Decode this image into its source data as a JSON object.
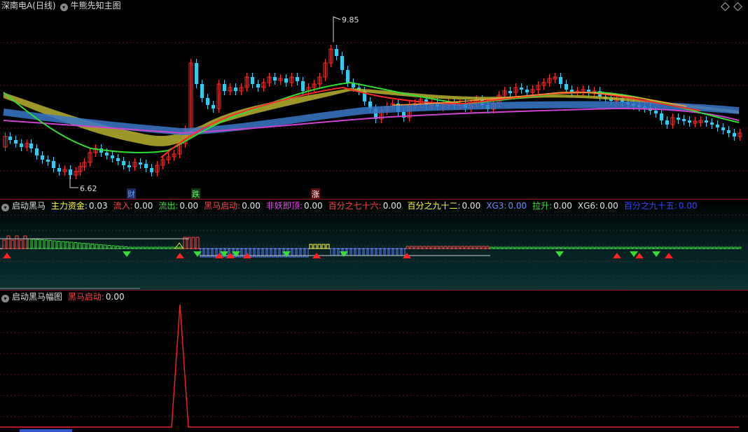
{
  "main": {
    "stock": "深南电A(日线)",
    "indicator": "牛熊先知主图",
    "high_label": "9.85",
    "low_label": "6.62",
    "markers": [
      {
        "text": "财",
        "color": "#4a8cff"
      },
      {
        "text": "跌",
        "color": "#33dd33"
      },
      {
        "text": "涨",
        "color": "#ff3333"
      }
    ]
  },
  "sub1": {
    "name": "启动黑马",
    "fields": [
      {
        "label": "主力资金:",
        "value": "0.03",
        "color": "#ffff33"
      },
      {
        "label": "流入:",
        "value": "0.00",
        "color": "#ff4444"
      },
      {
        "label": "流出:",
        "value": "0.00",
        "color": "#33dd33"
      },
      {
        "label": "黑马启动:",
        "value": "0.00",
        "color": "#ff4444"
      },
      {
        "label": "非妖即顶:",
        "value": "0.00",
        "color": "#ee44ee"
      },
      {
        "label": "百分之七十六:",
        "value": "0.00",
        "color": "#ff4444"
      },
      {
        "label": "百分之九十二:",
        "value": "0.00",
        "color": "#ffff33"
      },
      {
        "label": "XG3:",
        "value": "0.00",
        "color": "#6a8cff"
      },
      {
        "label": "拉升:",
        "value": "0.00",
        "color": "#33dd33"
      },
      {
        "label": "XG6:",
        "value": "0.00",
        "color": "#dddddd"
      },
      {
        "label": "百分之九十五:",
        "value": "0.00",
        "color": "#3344ff"
      }
    ]
  },
  "sub2": {
    "name": "启动黑马幅图",
    "fields": [
      {
        "label": "黑马启动:",
        "value": "0.00",
        "color": "#ff4444"
      }
    ]
  },
  "colors": {
    "up": "#ff3030",
    "down": "#33ccee",
    "grid": "#5a1515"
  }
}
